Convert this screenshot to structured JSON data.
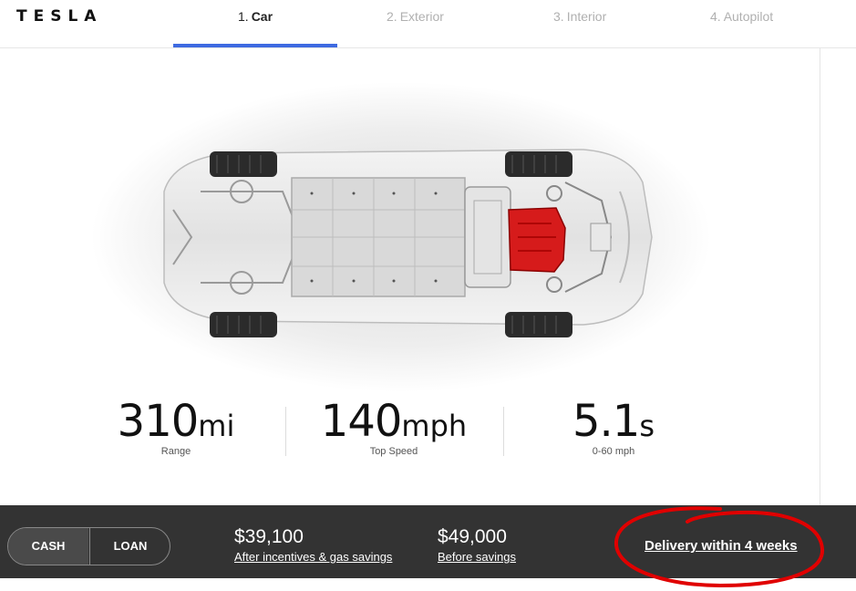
{
  "brand": {
    "logo_text": "TESLA"
  },
  "steps": [
    {
      "num": "1.",
      "label": "Car",
      "active": true
    },
    {
      "num": "2.",
      "label": "Exterior",
      "active": false
    },
    {
      "num": "3.",
      "label": "Interior",
      "active": false
    },
    {
      "num": "4.",
      "label": "Autopilot",
      "active": false
    }
  ],
  "stats": [
    {
      "value": "310",
      "unit": "mi",
      "caption": "Range"
    },
    {
      "value": "140",
      "unit": "mph",
      "caption": "Top Speed"
    },
    {
      "value": "5.1",
      "unit": "s",
      "caption": "0-60 mph"
    }
  ],
  "payment": {
    "cash_label": "CASH",
    "loan_label": "LOAN",
    "selected": "CASH"
  },
  "prices": [
    {
      "amount": "$39,100",
      "note": "After incentives & gas savings"
    },
    {
      "amount": "$49,000",
      "note": "Before savings"
    }
  ],
  "delivery": {
    "text": "Delivery within 4 weeks"
  },
  "colors": {
    "accent": "#3e6ae1",
    "bottom_bar": "#333333",
    "motor": "#d61b1b",
    "annotation": "#e00000"
  }
}
